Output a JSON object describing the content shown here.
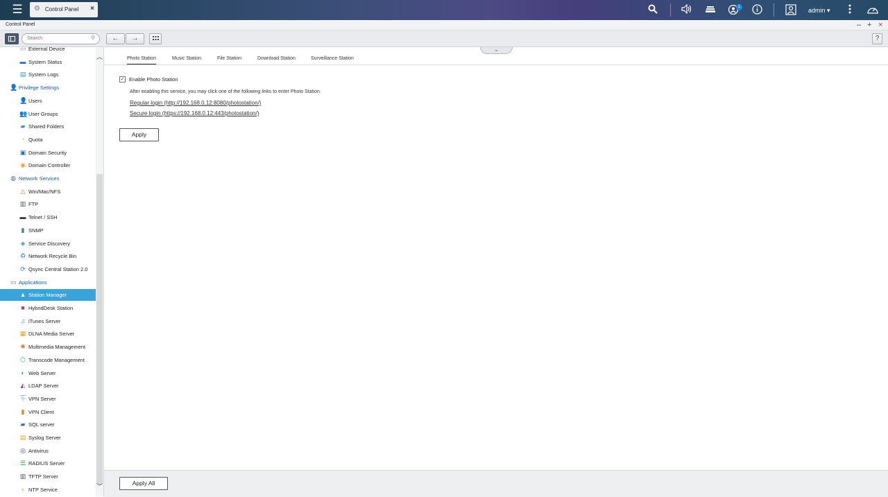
{
  "topbar": {
    "menu_icon": "hamburger-icon",
    "task_tab": {
      "icon": "gear-icon",
      "label": "Control Panel",
      "close": "×"
    },
    "icons": [
      "search-icon",
      "volume-icon",
      "tasks-icon",
      "notifications-icon",
      "info-icon",
      "user-icon",
      "more-icon",
      "dashboard-icon"
    ],
    "notification_count": "1",
    "user": "admin",
    "user_caret": "▾"
  },
  "window": {
    "title": "Control Panel",
    "minimize": "–",
    "maximize": "+",
    "close": "×"
  },
  "toolbar": {
    "search_placeholder": "Search",
    "back": "←",
    "forward": "→",
    "help": "?"
  },
  "sidebar": {
    "items": [
      {
        "label": "External Device",
        "type": "item",
        "icon": "device-icon"
      },
      {
        "label": "System Status",
        "type": "item",
        "icon": "monitor-icon"
      },
      {
        "label": "System Logs",
        "type": "item",
        "icon": "logs-icon"
      },
      {
        "label": "Privilege Settings",
        "type": "category",
        "icon": "user-icon"
      },
      {
        "label": "Users",
        "type": "item",
        "icon": "user-icon"
      },
      {
        "label": "User Groups",
        "type": "item",
        "icon": "group-icon"
      },
      {
        "label": "Shared Folders",
        "type": "item",
        "icon": "folder-icon"
      },
      {
        "label": "Quota",
        "type": "item",
        "icon": "quota-icon"
      },
      {
        "label": "Domain Security",
        "type": "item",
        "icon": "domain-security-icon"
      },
      {
        "label": "Domain Controller",
        "type": "item",
        "icon": "domain-controller-icon"
      },
      {
        "label": "Network Services",
        "type": "category",
        "icon": "network-icon"
      },
      {
        "label": "Win/Mac/NFS",
        "type": "item",
        "icon": "winmacnfs-icon"
      },
      {
        "label": "FTP",
        "type": "item",
        "icon": "ftp-icon"
      },
      {
        "label": "Telnet / SSH",
        "type": "item",
        "icon": "terminal-icon"
      },
      {
        "label": "SNMP",
        "type": "item",
        "icon": "snmp-icon"
      },
      {
        "label": "Service Discovery",
        "type": "item",
        "icon": "discovery-icon"
      },
      {
        "label": "Network Recycle Bin",
        "type": "item",
        "icon": "recycle-icon"
      },
      {
        "label": "Qsync Central Station 2.0",
        "type": "item",
        "icon": "sync-icon"
      },
      {
        "label": "Applications",
        "type": "category",
        "icon": "applications-icon"
      },
      {
        "label": "Station Manager",
        "type": "item",
        "icon": "station-icon",
        "active": true
      },
      {
        "label": "HybridDesk Station",
        "type": "item",
        "icon": "hybriddesk-icon"
      },
      {
        "label": "iTunes Server",
        "type": "item",
        "icon": "music-icon"
      },
      {
        "label": "DLNA Media Server",
        "type": "item",
        "icon": "dlna-icon"
      },
      {
        "label": "Multimedia Management",
        "type": "item",
        "icon": "multimedia-icon"
      },
      {
        "label": "Transcode Management",
        "type": "item",
        "icon": "transcode-icon"
      },
      {
        "label": "Web Server",
        "type": "item",
        "icon": "globe-icon"
      },
      {
        "label": "LDAP Server",
        "type": "item",
        "icon": "ldap-icon"
      },
      {
        "label": "VPN Server",
        "type": "item",
        "icon": "vpn-server-icon"
      },
      {
        "label": "VPN Client",
        "type": "item",
        "icon": "lock-icon"
      },
      {
        "label": "SQL server",
        "type": "item",
        "icon": "database-icon"
      },
      {
        "label": "Syslog Server",
        "type": "item",
        "icon": "syslog-icon"
      },
      {
        "label": "Antivirus",
        "type": "item",
        "icon": "antivirus-icon"
      },
      {
        "label": "RADIUS Server",
        "type": "item",
        "icon": "radius-icon"
      },
      {
        "label": "TFTP Server",
        "type": "item",
        "icon": "tftp-icon"
      },
      {
        "label": "NTP Service",
        "type": "item",
        "icon": "ntp-icon"
      }
    ]
  },
  "main": {
    "tabs": [
      "Photo Station",
      "Music Station",
      "File Station",
      "Download Station",
      "Surveillance Station"
    ],
    "active_tab": "Photo Station",
    "enable_label": "Enable Photo Station",
    "enable_checked": "☑",
    "info": "After enabling this service, you may click one of the following links to enter Photo Station.",
    "regular_login": "Regular login (http://192.168.0.12:8080/photostation/)",
    "secure_login": "Secure login (https://192.168.0.12:443/photostation/)",
    "apply": "Apply",
    "apply_all": "Apply All"
  }
}
